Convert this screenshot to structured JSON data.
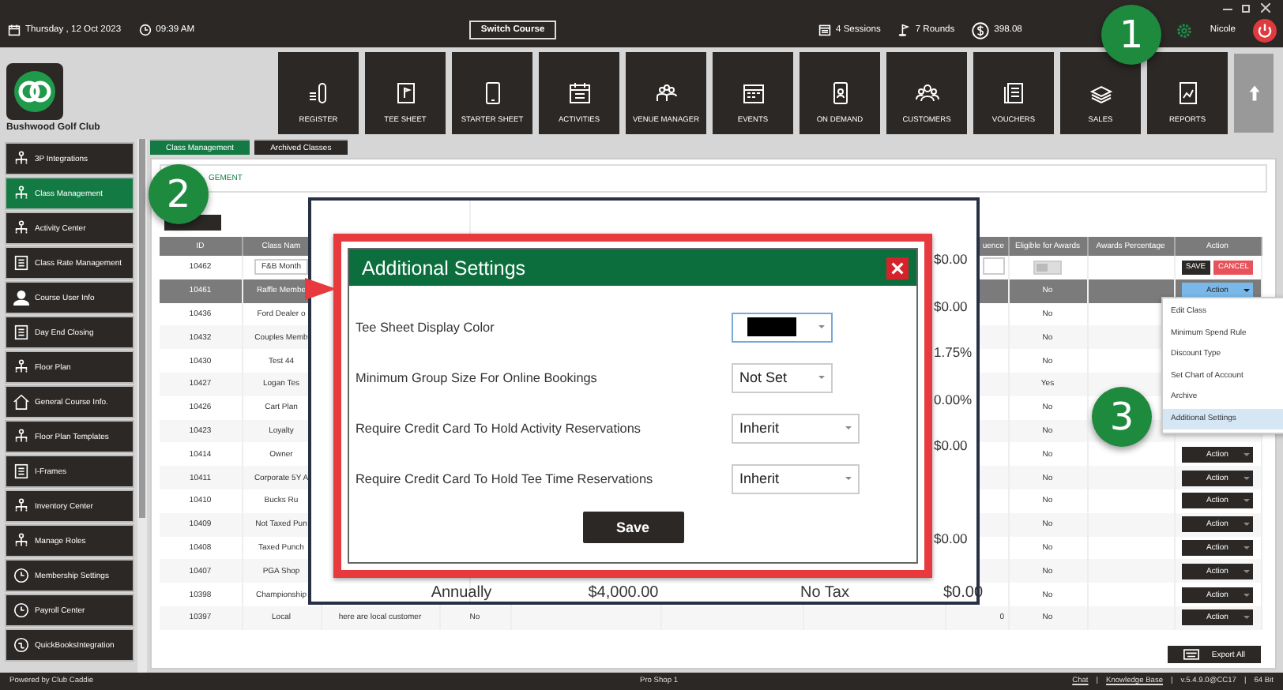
{
  "top_bar": {
    "date": "Thursday , 12 Oct 2023",
    "time": "09:39 AM",
    "switch_course": "Switch Course",
    "sessions": "4 Sessions",
    "rounds": "7 Rounds",
    "balance": "398.08",
    "user": "Nicole"
  },
  "club_name": "Bushwood Golf Club",
  "nav": [
    {
      "label": "REGISTER"
    },
    {
      "label": "TEE SHEET"
    },
    {
      "label": "STARTER SHEET"
    },
    {
      "label": "ACTIVITIES"
    },
    {
      "label": "VENUE MANAGER"
    },
    {
      "label": "EVENTS"
    },
    {
      "label": "ON DEMAND"
    },
    {
      "label": "CUSTOMERS"
    },
    {
      "label": "VOUCHERS"
    },
    {
      "label": "SALES"
    },
    {
      "label": "REPORTS"
    }
  ],
  "sidebar": {
    "items": [
      {
        "label": "3P Integrations",
        "selected": false
      },
      {
        "label": "Class Management",
        "selected": true
      },
      {
        "label": "Activity  Center",
        "selected": false
      },
      {
        "label": "Class Rate Management",
        "selected": false
      },
      {
        "label": "Course User Info",
        "selected": false
      },
      {
        "label": "Day End Closing",
        "selected": false
      },
      {
        "label": "Floor Plan",
        "selected": false
      },
      {
        "label": "General Course Info.",
        "selected": false
      },
      {
        "label": "Floor Plan Templates",
        "selected": false
      },
      {
        "label": "I-Frames",
        "selected": false
      },
      {
        "label": "Inventory Center",
        "selected": false
      },
      {
        "label": "Manage Roles",
        "selected": false
      },
      {
        "label": "Membership Settings",
        "selected": false
      },
      {
        "label": "Payroll Center",
        "selected": false
      },
      {
        "label": "QuickBooksIntegration",
        "selected": false
      }
    ]
  },
  "tabs": [
    {
      "label": "Class Management",
      "selected": true
    },
    {
      "label": "Archived Classes",
      "selected": false
    }
  ],
  "breadcrumb": "GEMENT",
  "table": {
    "columns": {
      "id": "ID",
      "name": "Class Nam",
      "sequence": "uence",
      "eligible": "Eligible for Awards",
      "awards": "Awards Percentage",
      "action": "Action"
    },
    "rows": [
      {
        "kind": "edit",
        "id": "10462",
        "name": "F&B Month",
        "toggle_on": false,
        "save": "SAVE",
        "cancel": "CANCEL",
        "selected": false
      },
      {
        "kind": "row",
        "id": "10461",
        "name": "Raffle Membe",
        "eligible": "No",
        "action": "Action",
        "expanded": true,
        "selected": true
      },
      {
        "kind": "row",
        "id": "10436",
        "name": "Ford Dealer o",
        "eligible": "No",
        "selected": false
      },
      {
        "kind": "row",
        "id": "10432",
        "name": "Couples Memb",
        "eligible": "No",
        "selected": false
      },
      {
        "kind": "row",
        "id": "10430",
        "name": "Test 44",
        "eligible": "No",
        "selected": false
      },
      {
        "kind": "row",
        "id": "10427",
        "name": "Logan Tes",
        "eligible": "Yes",
        "selected": false
      },
      {
        "kind": "row",
        "id": "10426",
        "name": "Cart Plan",
        "eligible": "No",
        "selected": false
      },
      {
        "kind": "row",
        "id": "10423",
        "name": "Loyalty",
        "eligible": "No",
        "selected": false
      },
      {
        "kind": "row",
        "id": "10414",
        "name": "Owner",
        "eligible": "No",
        "action": "Action",
        "expanded": false,
        "selected": false
      },
      {
        "kind": "row",
        "id": "10411",
        "name": "Corporate 5Y A",
        "eligible": "No",
        "action": "Action",
        "expanded": false,
        "selected": false
      },
      {
        "kind": "row",
        "id": "10410",
        "name": "Bucks Ru",
        "eligible": "No",
        "action": "Action",
        "expanded": false,
        "selected": false
      },
      {
        "kind": "row",
        "id": "10409",
        "name": "Not Taxed Pun",
        "eligible": "No",
        "action": "Action",
        "expanded": false,
        "selected": false
      },
      {
        "kind": "row",
        "id": "10408",
        "name": "Taxed Punch",
        "eligible": "No",
        "action": "Action",
        "expanded": false,
        "selected": false
      },
      {
        "kind": "row",
        "id": "10407",
        "name": "PGA Shop",
        "eligible": "No",
        "action": "Action",
        "expanded": false,
        "selected": false
      },
      {
        "kind": "row",
        "id": "10398",
        "name": "Championship",
        "eligible": "No",
        "action": "Action",
        "expanded": false,
        "selected": false
      },
      {
        "kind": "row",
        "id": "10397",
        "name": "Local",
        "column_3": "here are local customer",
        "column_4": "No",
        "sequence": "0",
        "eligible": "No",
        "action": "Action",
        "expanded": false,
        "selected": false
      }
    ]
  },
  "export_button": "Export All",
  "context_menu": [
    {
      "label": "Edit Class",
      "selected": false
    },
    {
      "label": "Minimum Spend Rule",
      "selected": false
    },
    {
      "label": "Discount Type",
      "selected": false
    },
    {
      "label": "Set Chart of Account",
      "selected": false
    },
    {
      "label": "Archive",
      "selected": false
    },
    {
      "label": "Additional Settings",
      "selected": true
    }
  ],
  "zoom_inset": {
    "values": [
      {
        "text": "$0.00"
      },
      {
        "text": "$0.00"
      },
      {
        "text": "1.75%"
      },
      {
        "text": "0.00%"
      },
      {
        "text": "$0.00"
      },
      {
        "gap": true
      },
      {
        "text": "$0.00"
      }
    ],
    "bottom_row": [
      "Annually",
      "$4,000.00",
      "No Tax",
      "$0.00"
    ]
  },
  "dialog": {
    "title": "Additional Settings",
    "fields": [
      {
        "kind": "color",
        "label": "Tee Sheet Display Color",
        "color": "#000000"
      },
      {
        "kind": "select",
        "label": "Minimum Group Size For Online Bookings",
        "value": "Not Set"
      },
      {
        "kind": "select",
        "label": "Require Credit Card To Hold Activity Reservations",
        "value": "Inherit"
      },
      {
        "kind": "select",
        "label": "Require Credit Card To Hold Tee Time Reservations",
        "value": "Inherit"
      }
    ],
    "save": "Save"
  },
  "badges": [
    "1",
    "2",
    "3"
  ],
  "footer": {
    "left": "Powered by Club Caddie",
    "center": "Pro Shop 1",
    "right": [
      {
        "kind": "link",
        "text": "Chat"
      },
      {
        "kind": "sep",
        "text": "|"
      },
      {
        "kind": "link",
        "text": "Knowledge Base"
      },
      {
        "kind": "sep",
        "text": "|"
      },
      {
        "kind": "text",
        "text": "v.5.4.9.0@CC17"
      },
      {
        "kind": "sep",
        "text": "|"
      },
      {
        "kind": "text",
        "text": "64 Bit"
      }
    ]
  }
}
